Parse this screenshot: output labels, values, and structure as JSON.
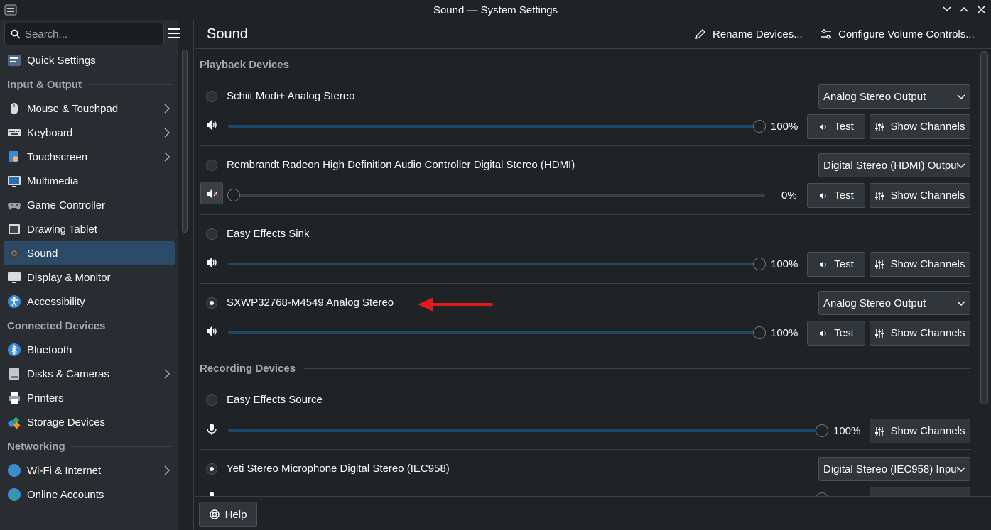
{
  "window": {
    "title": "Sound — System Settings"
  },
  "search": {
    "placeholder": "Search..."
  },
  "sidebar": {
    "items": [
      {
        "label": "Quick Settings",
        "icon": "quick-settings-icon"
      },
      {
        "section": "Input & Output"
      },
      {
        "label": "Mouse & Touchpad",
        "icon": "mouse-icon",
        "chevron": true
      },
      {
        "label": "Keyboard",
        "icon": "keyboard-icon",
        "chevron": true
      },
      {
        "label": "Touchscreen",
        "icon": "touchscreen-icon",
        "chevron": true
      },
      {
        "label": "Multimedia",
        "icon": "multimedia-icon"
      },
      {
        "label": "Game Controller",
        "icon": "gamepad-icon"
      },
      {
        "label": "Drawing Tablet",
        "icon": "tablet-icon"
      },
      {
        "label": "Sound",
        "icon": "sound-icon",
        "active": true
      },
      {
        "label": "Display & Monitor",
        "icon": "monitor-icon"
      },
      {
        "label": "Accessibility",
        "icon": "accessibility-icon"
      },
      {
        "section": "Connected Devices"
      },
      {
        "label": "Bluetooth",
        "icon": "bluetooth-icon"
      },
      {
        "label": "Disks & Cameras",
        "icon": "disk-icon",
        "chevron": true
      },
      {
        "label": "Printers",
        "icon": "printer-icon"
      },
      {
        "label": "Storage Devices",
        "icon": "storage-icon"
      },
      {
        "section": "Networking"
      },
      {
        "label": "Wi-Fi & Internet",
        "icon": "globe-icon",
        "chevron": true
      },
      {
        "label": "Online Accounts",
        "icon": "online-accounts-icon"
      }
    ]
  },
  "header": {
    "title": "Sound",
    "rename_label": "Rename Devices...",
    "configure_label": "Configure Volume Controls..."
  },
  "playback": {
    "title": "Playback Devices",
    "devices": [
      {
        "name": "Schiit Modi+ Analog Stereo",
        "profile": "Analog Stereo Output",
        "volume": "100%",
        "level": 1.0,
        "muted": false,
        "default": false
      },
      {
        "name": "Rembrandt Radeon High Definition Audio Controller Digital Stereo (HDMI)",
        "profile": "Digital Stereo (HDMI) Output",
        "volume": "0%",
        "level": 0.0,
        "muted": true,
        "default": false
      },
      {
        "name": "Easy Effects Sink",
        "profile": "",
        "volume": "100%",
        "level": 1.0,
        "muted": false,
        "default": false
      },
      {
        "name": "SXWP32768-M4549 Analog Stereo",
        "profile": "Analog Stereo Output",
        "volume": "100%",
        "level": 1.0,
        "muted": false,
        "default": true
      }
    ],
    "test_label": "Test",
    "channels_label": "Show Channels"
  },
  "recording": {
    "title": "Recording Devices",
    "devices": [
      {
        "name": "Easy Effects Source",
        "profile": "",
        "volume": "100%",
        "level": 1.0,
        "default": false
      },
      {
        "name": "Yeti Stereo Microphone Digital Stereo (IEC958)",
        "profile": "Digital Stereo (IEC958) Input",
        "volume": "",
        "level": 1.0,
        "default": true
      }
    ],
    "channels_label": "Show Channels"
  },
  "footer": {
    "help_label": "Help"
  },
  "colors": {
    "background": "#202326",
    "sidebar": "#292c30",
    "accent": "#2b4a68",
    "slider_fill": "#1d4868",
    "annotation_arrow": "#e01b1b"
  }
}
